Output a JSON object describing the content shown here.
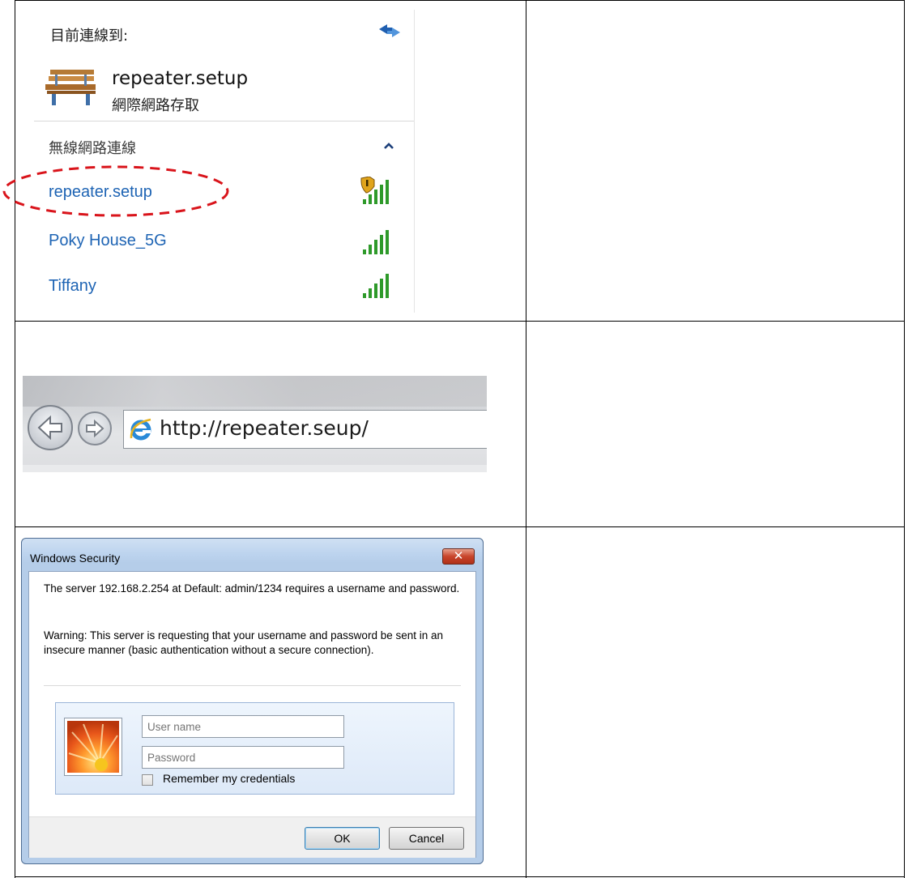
{
  "wifi_panel": {
    "connected_title": "目前連線到:",
    "connection_name": "repeater.setup",
    "connection_status": "網際網路存取",
    "section_title": "無線網路連線",
    "networks": [
      {
        "name": "repeater.setup",
        "secured": true
      },
      {
        "name": "Poky House_5G",
        "secured": false
      },
      {
        "name": "Tiffany",
        "secured": false
      }
    ],
    "colors": {
      "network_link": "#1e64b4",
      "highlight_oval": "#d9141b",
      "signal": "#2e9a2a"
    }
  },
  "browser": {
    "url": "http://repeater.seup/"
  },
  "security_dialog": {
    "title": "Windows Security",
    "message": "The server 192.168.2.254 at Default: admin/1234 requires a username and password.",
    "warning": "Warning: This server is requesting that your username and password be sent in an insecure manner (basic authentication without a secure connection).",
    "username_placeholder": "User name",
    "password_placeholder": "Password",
    "remember_label": "Remember my credentials",
    "remember_checked": false,
    "ok_label": "OK",
    "cancel_label": "Cancel"
  }
}
